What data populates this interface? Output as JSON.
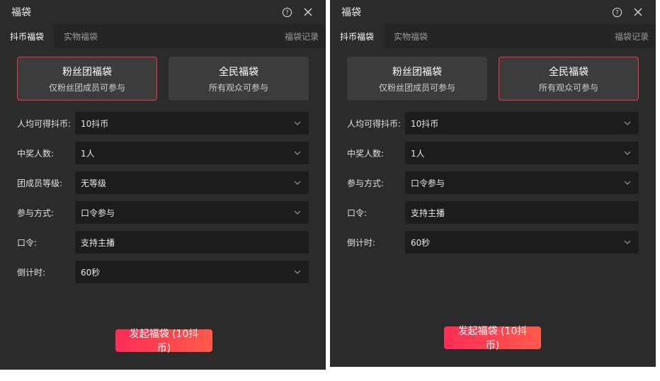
{
  "left": {
    "title": "福袋",
    "tabs": {
      "douyin_coin": "抖币福袋",
      "physical": "实物福袋",
      "records": "福袋记录"
    },
    "types": [
      {
        "title": "粉丝团福袋",
        "desc": "仅粉丝团成员可参与",
        "selected": true
      },
      {
        "title": "全民福袋",
        "desc": "所有观众可参与",
        "selected": false
      }
    ],
    "fields": [
      {
        "label": "人均可得抖币:",
        "value": "10抖币",
        "dropdown": true
      },
      {
        "label": "中奖人数:",
        "value": "1人",
        "dropdown": true
      },
      {
        "label": "团成员等级:",
        "value": "无等级",
        "dropdown": true
      },
      {
        "label": "参与方式:",
        "value": "口令参与",
        "dropdown": true
      },
      {
        "label": "口令:",
        "value": "支持主播",
        "dropdown": false
      },
      {
        "label": "倒计时:",
        "value": "60秒",
        "dropdown": true
      }
    ],
    "submit_label": "发起福袋 (10抖币)"
  },
  "right": {
    "title": "福袋",
    "tabs": {
      "douyin_coin": "抖币福袋",
      "physical": "实物福袋",
      "records": "福袋记录"
    },
    "types": [
      {
        "title": "粉丝团福袋",
        "desc": "仅粉丝团成员可参与",
        "selected": false
      },
      {
        "title": "全民福袋",
        "desc": "所有观众可参与",
        "selected": true
      }
    ],
    "fields": [
      {
        "label": "人均可得抖币:",
        "value": "10抖币",
        "dropdown": true
      },
      {
        "label": "中奖人数:",
        "value": "1人",
        "dropdown": true
      },
      {
        "label": "参与方式:",
        "value": "口令参与",
        "dropdown": true
      },
      {
        "label": "口令:",
        "value": "支持主播",
        "dropdown": false
      },
      {
        "label": "倒计时:",
        "value": "60秒",
        "dropdown": true
      }
    ],
    "submit_label": "发起福袋 (10抖币)"
  },
  "colors": {
    "accent": "#fe2c55",
    "panel_bg": "#2b2b2b",
    "field_bg": "#1c1c1c",
    "card_bg": "#3c3c3c"
  },
  "icons": {
    "help": "help-circle-icon",
    "close": "close-icon",
    "dropdown": "chevron-down-icon"
  }
}
